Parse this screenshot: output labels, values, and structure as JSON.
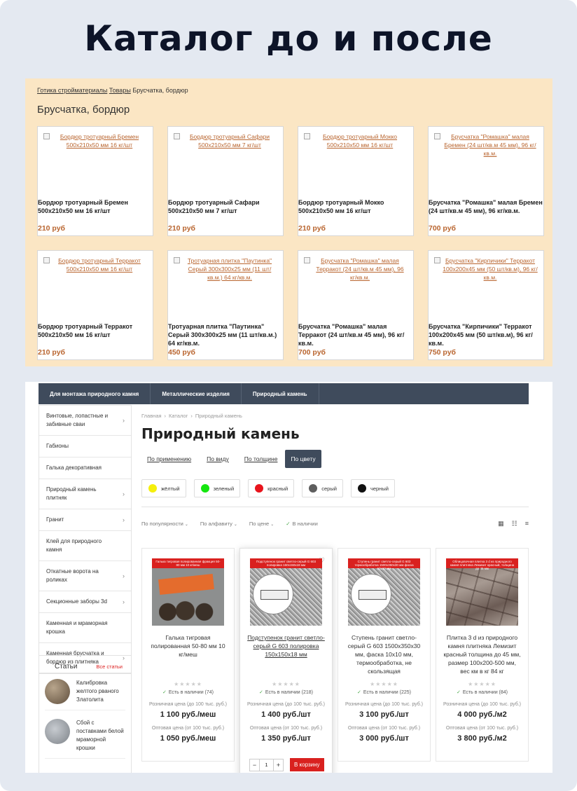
{
  "headline": "Каталог до и после",
  "old_catalog": {
    "breadcrumb": [
      "Готика стройматериалы",
      "Товары"
    ],
    "breadcrumb_current": "Брусчатка, бордюр",
    "title": "Брусчатка, бордюр",
    "products": [
      {
        "alt": "Бордюр тротуарный Бремен 500x210x50 мм 16 кг/шт",
        "name": "Бордюр тротуарный Бремен 500x210x50 мм 16 кг/шт",
        "price": "210 руб"
      },
      {
        "alt": "Бордюр тротуарный Сафари 500x210x50 мм 7 кг/шт",
        "name": "Бордюр тротуарный Сафари 500x210x50 мм 7 кг/шт",
        "price": "210 руб"
      },
      {
        "alt": "Бордюр тротуарный Мокко 500x210x50 мм 16 кг/шт",
        "name": "Бордюр тротуарный Мокко 500x210x50 мм 16 кг/шт",
        "price": "210 руб"
      },
      {
        "alt": "Брусчатка \"Ромашка\" малая Бремен (24 шт/кв.м 45 мм), 96 кг/кв.м.",
        "name": "Брусчатка \"Ромашка\" малая Бремен (24 шт/кв.м 45 мм), 96 кг/кв.м.",
        "price": "700 руб"
      },
      {
        "alt": "Бордюр тротуарный Терракот 500x210x50 мм 16 кг/шт",
        "name": "Бордюр тротуарный Терракот 500x210x50 мм 16 кг/шт",
        "price": "210 руб"
      },
      {
        "alt": "Тротуарная плитка \"Паутинка\" Серый 300x300x25 мм (11 шт/кв.м.) 64 кг/кв.м.",
        "name": "Тротуарная плитка \"Паутинка\" Серый 300x300x25 мм (11 шт/кв.м.) 64 кг/кв.м.",
        "price": "450 руб"
      },
      {
        "alt": "Брусчатка \"Ромашка\" малая Терракот (24 шт/кв.м 45 мм), 96 кг/кв.м.",
        "name": "Брусчатка \"Ромашка\" малая Терракот (24 шт/кв.м 45 мм), 96 кг/кв.м.",
        "price": "700 руб"
      },
      {
        "alt": "Брусчатка \"Кирпичики\" Терракот 100x200x45 мм (50 шт/кв.м), 96 кг/кв.м.",
        "name": "Брусчатка \"Кирпичики\" Терракот 100x200x45 мм (50 шт/кв.м), 96 кг/кв.м.",
        "price": "750 руб"
      }
    ]
  },
  "new_catalog": {
    "topnav": [
      "Для монтажа природного камня",
      "Металлические изделия",
      "Природный камень"
    ],
    "sidebar": [
      {
        "label": "Винтовые, лопастные и забивные сваи",
        "chevron": true
      },
      {
        "label": "Габионы",
        "chevron": false
      },
      {
        "label": "Галька декоративная",
        "chevron": false
      },
      {
        "label": "Природный камень плитняк",
        "chevron": true
      },
      {
        "label": "Гранит",
        "chevron": true
      },
      {
        "label": "Клей для природного камня",
        "chevron": false
      },
      {
        "label": "Откатные ворота на роликах",
        "chevron": true
      },
      {
        "label": "Секционные заборы 3d",
        "chevron": true
      },
      {
        "label": "Каменная и мраморная крошка",
        "chevron": false
      },
      {
        "label": "Каменная брусчатка и бордюр из плитняка",
        "chevron": true
      }
    ],
    "articles": {
      "title": "Статьи",
      "all_link": "Все статьи",
      "items": [
        {
          "text": "Калибровка желтого рваного Златолита"
        },
        {
          "text": "Сбой с поставками белой мраморной крошки"
        }
      ]
    },
    "breadcrumb": [
      "Главная",
      "Каталог",
      "Природный камень"
    ],
    "title": "Природный камень",
    "tabs": [
      "По применению",
      "По виду",
      "По толщине",
      "По цвету"
    ],
    "active_tab": "По цвету",
    "colors": [
      {
        "label": "жёлтый",
        "color": "#f5ef0c"
      },
      {
        "label": "зеленый",
        "color": "#14e60f"
      },
      {
        "label": "красный",
        "color": "#e8141c"
      },
      {
        "label": "серый",
        "color": "#5e5e5e"
      },
      {
        "label": "черный",
        "color": "#111111"
      }
    ],
    "sorts": [
      "По популярности",
      "По алфавиту",
      "По цене"
    ],
    "in_stock_filter": "В наличии",
    "products": [
      {
        "band": "Галька тигровая полированная фракция 50-80 мм 10 кг/меш",
        "name": "Галька тигровая полированная 50-80 мм 10 кг/меш",
        "stock": "Есть в наличии (74)",
        "retail_label": "Розничная цена (до 100 тыс. руб.)",
        "retail_price": "1 100 руб./меш",
        "wholesale_label": "Оптовая цена (от 100 тыс. руб.)",
        "wholesale_price": "1 050 руб./меш",
        "img": "pebble"
      },
      {
        "band": "Подступенок гранит светло-серый G 603 полировка 150x150x18 мм",
        "name": "Подступенок гранит светло-серый G 603 полировка 150x150x18 мм",
        "stock": "Есть в наличии (218)",
        "retail_label": "Розничная цена (до 100 тыс. руб.)",
        "retail_price": "1 400 руб./шт",
        "wholesale_label": "Оптовая цена (от 100 тыс. руб.)",
        "wholesale_price": "1 350 руб./шт",
        "img": "granite"
      },
      {
        "band": "Ступень гранит светло-серый G 603 термообработка 1500x350x30 мм фаска 10x10 мм",
        "name": "Ступень гранит светло-серый G 603 1500x350x30 мм, фаска 10x10 мм, термообработка, не скользящая",
        "stock": "Есть в наличии (225)",
        "retail_label": "Розничная цена (до 100 тыс. руб.)",
        "retail_price": "3 100 руб./шт",
        "wholesale_label": "Оптовая цена (от 100 тыс. руб.)",
        "wholesale_price": "3 000 руб./шт",
        "img": "granite"
      },
      {
        "band": "Облицовочная плитка 3 d из природного камня плитняка Лемизит красный, толщина до 45 мм",
        "name": "Плитка 3 d из природного камня плитняка Лемизит красный толщина до 45 мм, размер 100x200-500 мм, вес км в кг 84 кг",
        "stock": "Есть в наличии (84)",
        "retail_label": "Розничная цена (до 100 тыс. руб.)",
        "retail_price": "4 000 руб./м2",
        "wholesale_label": "Оптовая цена (от 100 тыс. руб.)",
        "wholesale_price": "3 800 руб./м2",
        "img": "tiles"
      }
    ],
    "qty": "1",
    "cart_label": "В корзину"
  }
}
